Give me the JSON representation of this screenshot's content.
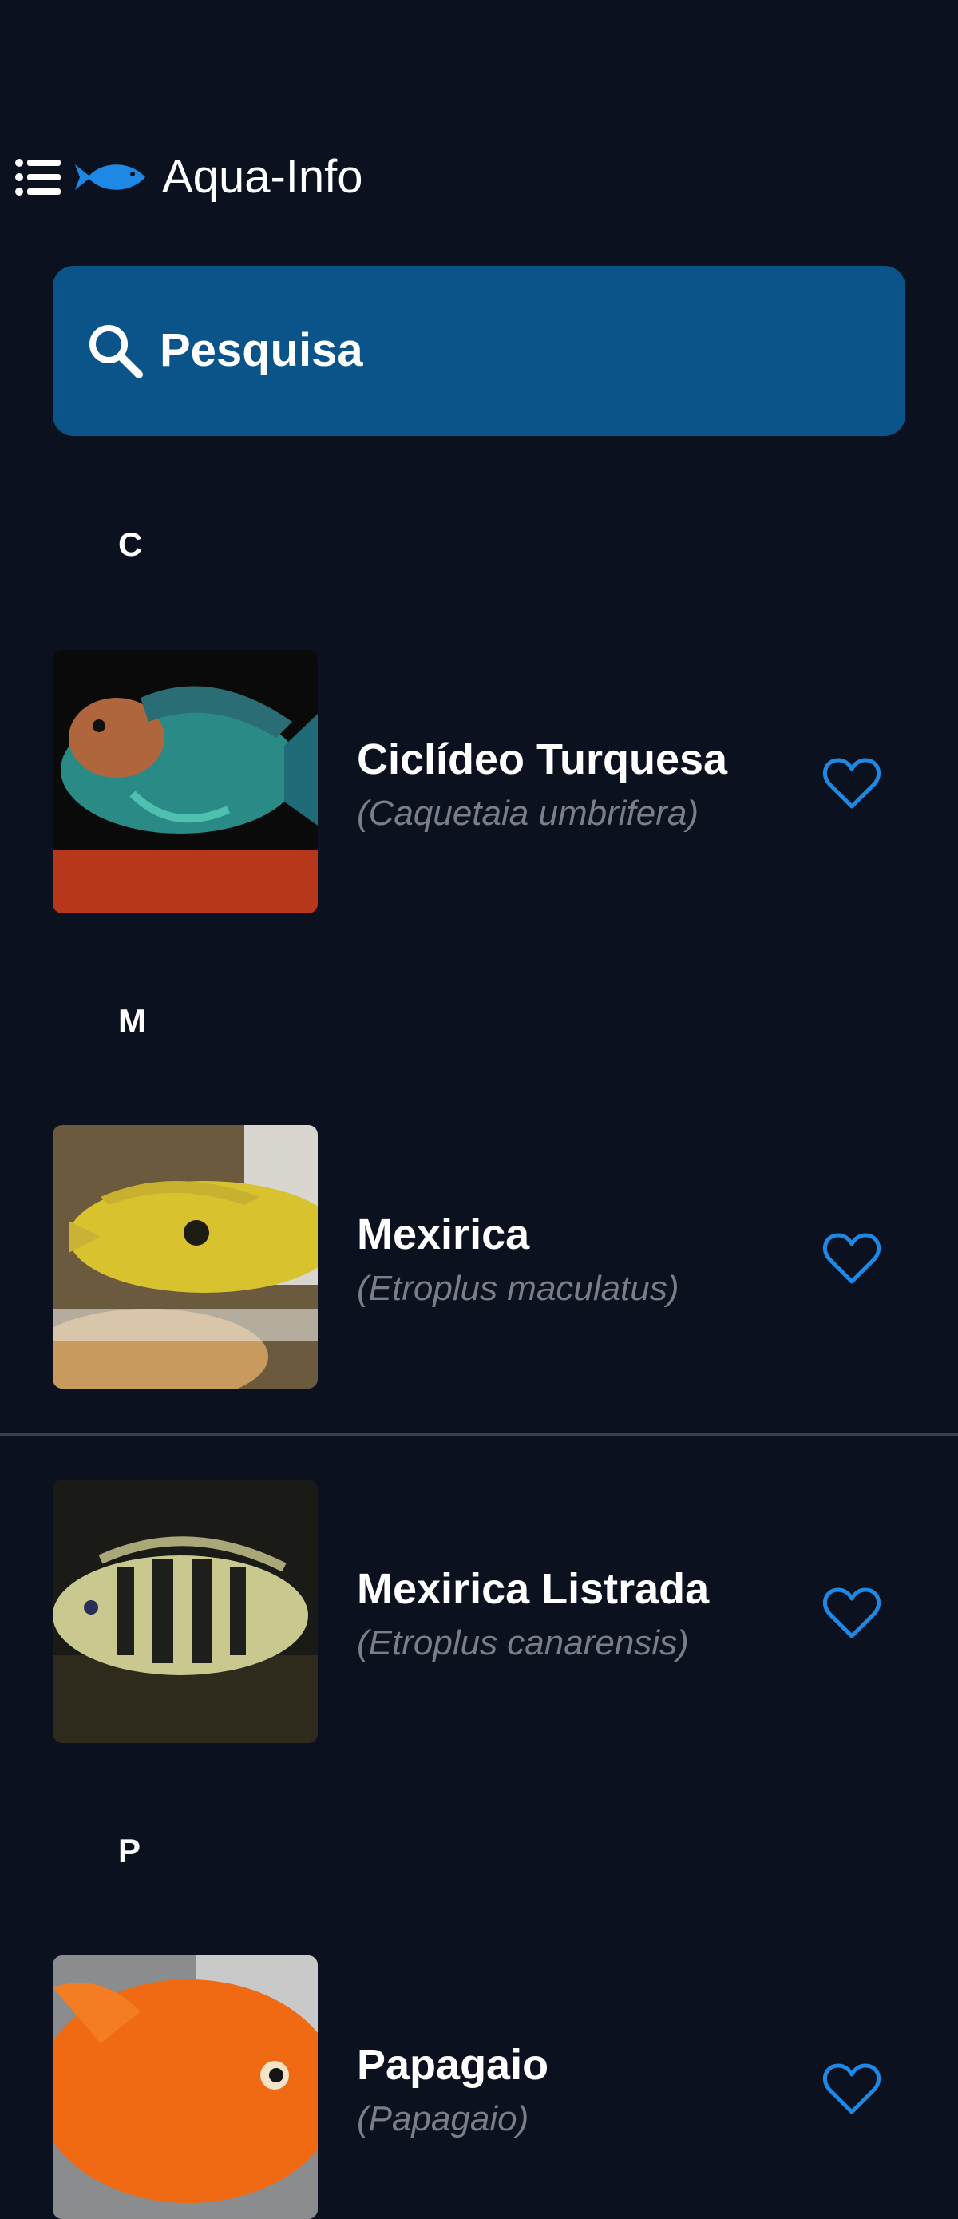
{
  "app": {
    "title": "Aqua-Info",
    "menu_icon": "list-menu-icon",
    "logo_icon": "fish-logo-icon"
  },
  "search": {
    "label": "Pesquisa",
    "icon": "search-icon"
  },
  "sections": [
    {
      "letter": "C",
      "items": [
        {
          "name": "Ciclídeo Turquesa",
          "scientific": "(Caquetaia umbrifera)",
          "favorite_icon": "heart-outline-icon"
        }
      ]
    },
    {
      "letter": "M",
      "items": [
        {
          "name": "Mexirica",
          "scientific": "(Etroplus maculatus)",
          "favorite_icon": "heart-outline-icon"
        },
        {
          "name": "Mexirica Listrada",
          "scientific": "(Etroplus canarensis)",
          "favorite_icon": "heart-outline-icon"
        }
      ]
    },
    {
      "letter": "P",
      "items": [
        {
          "name": "Papagaio",
          "scientific": "(Papagaio)",
          "favorite_icon": "heart-outline-icon"
        }
      ]
    }
  ],
  "colors": {
    "background": "#0c1120",
    "search_bar": "#0b548a",
    "accent": "#1e88e5",
    "subtitle": "#7b7e86"
  }
}
